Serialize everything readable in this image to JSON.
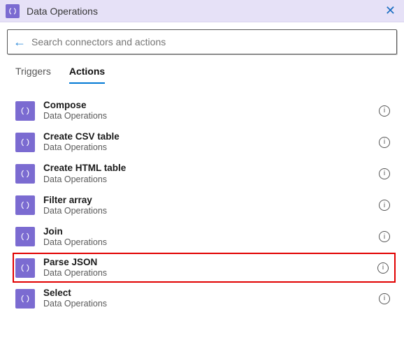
{
  "header": {
    "title": "Data Operations"
  },
  "search": {
    "placeholder": "Search connectors and actions"
  },
  "tabs": [
    {
      "label": "Triggers",
      "active": false
    },
    {
      "label": "Actions",
      "active": true
    }
  ],
  "provider": "Data Operations",
  "actions": [
    {
      "title": "Compose",
      "subtitle": "Data Operations",
      "highlighted": false
    },
    {
      "title": "Create CSV table",
      "subtitle": "Data Operations",
      "highlighted": false
    },
    {
      "title": "Create HTML table",
      "subtitle": "Data Operations",
      "highlighted": false
    },
    {
      "title": "Filter array",
      "subtitle": "Data Operations",
      "highlighted": false
    },
    {
      "title": "Join",
      "subtitle": "Data Operations",
      "highlighted": false
    },
    {
      "title": "Parse JSON",
      "subtitle": "Data Operations",
      "highlighted": true
    },
    {
      "title": "Select",
      "subtitle": "Data Operations",
      "highlighted": false
    }
  ]
}
